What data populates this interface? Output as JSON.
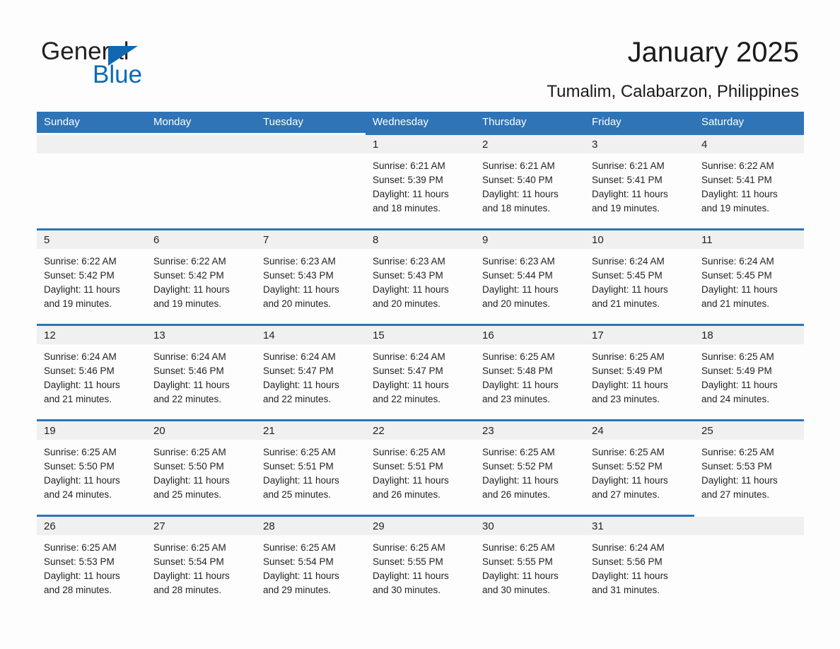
{
  "brand": {
    "name_part1": "General",
    "name_part2": "Blue",
    "accent_color": "#2e74b6"
  },
  "header": {
    "title": "January 2025",
    "subtitle": "Tumalim, Calabarzon, Philippines"
  },
  "calendar": {
    "weekdays": [
      "Sunday",
      "Monday",
      "Tuesday",
      "Wednesday",
      "Thursday",
      "Friday",
      "Saturday"
    ],
    "weeks": [
      [
        {
          "day": "",
          "blank": true,
          "lead": true,
          "sunrise": "",
          "sunset": "",
          "daylight1": "",
          "daylight2": ""
        },
        {
          "day": "",
          "blank": true,
          "lead": true,
          "sunrise": "",
          "sunset": "",
          "daylight1": "",
          "daylight2": ""
        },
        {
          "day": "",
          "blank": true,
          "lead": true,
          "sunrise": "",
          "sunset": "",
          "daylight1": "",
          "daylight2": ""
        },
        {
          "day": "1",
          "sunrise": "Sunrise: 6:21 AM",
          "sunset": "Sunset: 5:39 PM",
          "daylight1": "Daylight: 11 hours",
          "daylight2": "and 18 minutes."
        },
        {
          "day": "2",
          "sunrise": "Sunrise: 6:21 AM",
          "sunset": "Sunset: 5:40 PM",
          "daylight1": "Daylight: 11 hours",
          "daylight2": "and 18 minutes."
        },
        {
          "day": "3",
          "sunrise": "Sunrise: 6:21 AM",
          "sunset": "Sunset: 5:41 PM",
          "daylight1": "Daylight: 11 hours",
          "daylight2": "and 19 minutes."
        },
        {
          "day": "4",
          "sunrise": "Sunrise: 6:22 AM",
          "sunset": "Sunset: 5:41 PM",
          "daylight1": "Daylight: 11 hours",
          "daylight2": "and 19 minutes."
        }
      ],
      [
        {
          "day": "5",
          "sunrise": "Sunrise: 6:22 AM",
          "sunset": "Sunset: 5:42 PM",
          "daylight1": "Daylight: 11 hours",
          "daylight2": "and 19 minutes."
        },
        {
          "day": "6",
          "sunrise": "Sunrise: 6:22 AM",
          "sunset": "Sunset: 5:42 PM",
          "daylight1": "Daylight: 11 hours",
          "daylight2": "and 19 minutes."
        },
        {
          "day": "7",
          "sunrise": "Sunrise: 6:23 AM",
          "sunset": "Sunset: 5:43 PM",
          "daylight1": "Daylight: 11 hours",
          "daylight2": "and 20 minutes."
        },
        {
          "day": "8",
          "sunrise": "Sunrise: 6:23 AM",
          "sunset": "Sunset: 5:43 PM",
          "daylight1": "Daylight: 11 hours",
          "daylight2": "and 20 minutes."
        },
        {
          "day": "9",
          "sunrise": "Sunrise: 6:23 AM",
          "sunset": "Sunset: 5:44 PM",
          "daylight1": "Daylight: 11 hours",
          "daylight2": "and 20 minutes."
        },
        {
          "day": "10",
          "sunrise": "Sunrise: 6:24 AM",
          "sunset": "Sunset: 5:45 PM",
          "daylight1": "Daylight: 11 hours",
          "daylight2": "and 21 minutes."
        },
        {
          "day": "11",
          "sunrise": "Sunrise: 6:24 AM",
          "sunset": "Sunset: 5:45 PM",
          "daylight1": "Daylight: 11 hours",
          "daylight2": "and 21 minutes."
        }
      ],
      [
        {
          "day": "12",
          "sunrise": "Sunrise: 6:24 AM",
          "sunset": "Sunset: 5:46 PM",
          "daylight1": "Daylight: 11 hours",
          "daylight2": "and 21 minutes."
        },
        {
          "day": "13",
          "sunrise": "Sunrise: 6:24 AM",
          "sunset": "Sunset: 5:46 PM",
          "daylight1": "Daylight: 11 hours",
          "daylight2": "and 22 minutes."
        },
        {
          "day": "14",
          "sunrise": "Sunrise: 6:24 AM",
          "sunset": "Sunset: 5:47 PM",
          "daylight1": "Daylight: 11 hours",
          "daylight2": "and 22 minutes."
        },
        {
          "day": "15",
          "sunrise": "Sunrise: 6:24 AM",
          "sunset": "Sunset: 5:47 PM",
          "daylight1": "Daylight: 11 hours",
          "daylight2": "and 22 minutes."
        },
        {
          "day": "16",
          "sunrise": "Sunrise: 6:25 AM",
          "sunset": "Sunset: 5:48 PM",
          "daylight1": "Daylight: 11 hours",
          "daylight2": "and 23 minutes."
        },
        {
          "day": "17",
          "sunrise": "Sunrise: 6:25 AM",
          "sunset": "Sunset: 5:49 PM",
          "daylight1": "Daylight: 11 hours",
          "daylight2": "and 23 minutes."
        },
        {
          "day": "18",
          "sunrise": "Sunrise: 6:25 AM",
          "sunset": "Sunset: 5:49 PM",
          "daylight1": "Daylight: 11 hours",
          "daylight2": "and 24 minutes."
        }
      ],
      [
        {
          "day": "19",
          "sunrise": "Sunrise: 6:25 AM",
          "sunset": "Sunset: 5:50 PM",
          "daylight1": "Daylight: 11 hours",
          "daylight2": "and 24 minutes."
        },
        {
          "day": "20",
          "sunrise": "Sunrise: 6:25 AM",
          "sunset": "Sunset: 5:50 PM",
          "daylight1": "Daylight: 11 hours",
          "daylight2": "and 25 minutes."
        },
        {
          "day": "21",
          "sunrise": "Sunrise: 6:25 AM",
          "sunset": "Sunset: 5:51 PM",
          "daylight1": "Daylight: 11 hours",
          "daylight2": "and 25 minutes."
        },
        {
          "day": "22",
          "sunrise": "Sunrise: 6:25 AM",
          "sunset": "Sunset: 5:51 PM",
          "daylight1": "Daylight: 11 hours",
          "daylight2": "and 26 minutes."
        },
        {
          "day": "23",
          "sunrise": "Sunrise: 6:25 AM",
          "sunset": "Sunset: 5:52 PM",
          "daylight1": "Daylight: 11 hours",
          "daylight2": "and 26 minutes."
        },
        {
          "day": "24",
          "sunrise": "Sunrise: 6:25 AM",
          "sunset": "Sunset: 5:52 PM",
          "daylight1": "Daylight: 11 hours",
          "daylight2": "and 27 minutes."
        },
        {
          "day": "25",
          "sunrise": "Sunrise: 6:25 AM",
          "sunset": "Sunset: 5:53 PM",
          "daylight1": "Daylight: 11 hours",
          "daylight2": "and 27 minutes."
        }
      ],
      [
        {
          "day": "26",
          "sunrise": "Sunrise: 6:25 AM",
          "sunset": "Sunset: 5:53 PM",
          "daylight1": "Daylight: 11 hours",
          "daylight2": "and 28 minutes."
        },
        {
          "day": "27",
          "sunrise": "Sunrise: 6:25 AM",
          "sunset": "Sunset: 5:54 PM",
          "daylight1": "Daylight: 11 hours",
          "daylight2": "and 28 minutes."
        },
        {
          "day": "28",
          "sunrise": "Sunrise: 6:25 AM",
          "sunset": "Sunset: 5:54 PM",
          "daylight1": "Daylight: 11 hours",
          "daylight2": "and 29 minutes."
        },
        {
          "day": "29",
          "sunrise": "Sunrise: 6:25 AM",
          "sunset": "Sunset: 5:55 PM",
          "daylight1": "Daylight: 11 hours",
          "daylight2": "and 30 minutes."
        },
        {
          "day": "30",
          "sunrise": "Sunrise: 6:25 AM",
          "sunset": "Sunset: 5:55 PM",
          "daylight1": "Daylight: 11 hours",
          "daylight2": "and 30 minutes."
        },
        {
          "day": "31",
          "sunrise": "Sunrise: 6:24 AM",
          "sunset": "Sunset: 5:56 PM",
          "daylight1": "Daylight: 11 hours",
          "daylight2": "and 31 minutes."
        },
        {
          "day": "",
          "blank": true,
          "trail": true,
          "sunrise": "",
          "sunset": "",
          "daylight1": "",
          "daylight2": ""
        }
      ]
    ]
  }
}
